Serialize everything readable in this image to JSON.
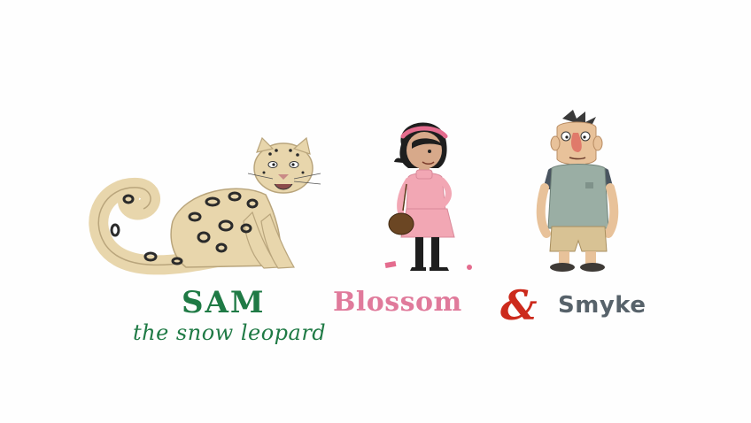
{
  "titles": {
    "sam": "SAM",
    "sam_subtitle": "the snow leopard",
    "blossom": "Blossom",
    "ampersand": "&",
    "smyke": "Smyke"
  },
  "colors": {
    "sam_text": "#1f7a45",
    "blossom_text": "#e07a9b",
    "ampersand": "#cc2a1c",
    "smyke_text": "#57626a",
    "leopard_fur": "#e8d6ac",
    "blossom_dress": "#f2a7b4",
    "smyke_vest": "#9aaea4"
  },
  "icons": {
    "sam": "snow-leopard-illustration",
    "blossom": "blossom-girl-illustration",
    "smyke": "smyke-man-illustration"
  }
}
